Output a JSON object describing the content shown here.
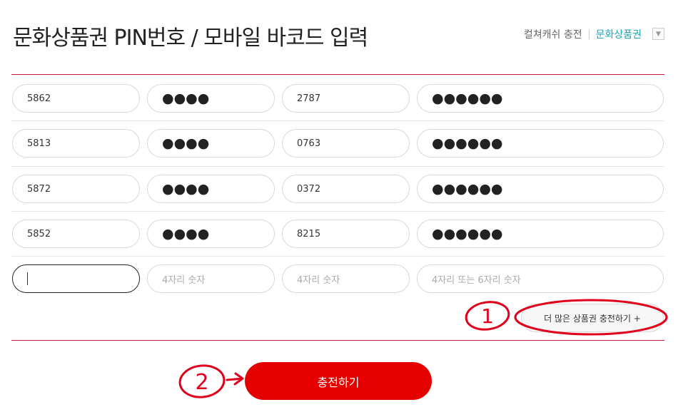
{
  "header": {
    "title": "문화상품권 PIN번호 / 모바일 바코드 입력",
    "link_culture_cash": "컬쳐캐쉬 충전",
    "link_gift_card": "문화상품권"
  },
  "pin_rows": [
    {
      "f1": "5862",
      "f2": "●●●●",
      "f3": "2787",
      "f4": "●●●●●●"
    },
    {
      "f1": "5813",
      "f2": "●●●●",
      "f3": "0763",
      "f4": "●●●●●●"
    },
    {
      "f1": "5872",
      "f2": "●●●●",
      "f3": "0372",
      "f4": "●●●●●●"
    },
    {
      "f1": "5852",
      "f2": "●●●●",
      "f3": "8215",
      "f4": "●●●●●●"
    }
  ],
  "empty_row": {
    "f2_placeholder": "4자리 숫자",
    "f3_placeholder": "4자리 숫자",
    "f4_placeholder": "4자리 또는 6자리 숫자"
  },
  "buttons": {
    "more_label": "더 많은 상품권 충전하기 +",
    "charge_label": "충전하기"
  },
  "annotations": {
    "mark_1": "1",
    "mark_2": "2",
    "color": "#e0001b"
  }
}
